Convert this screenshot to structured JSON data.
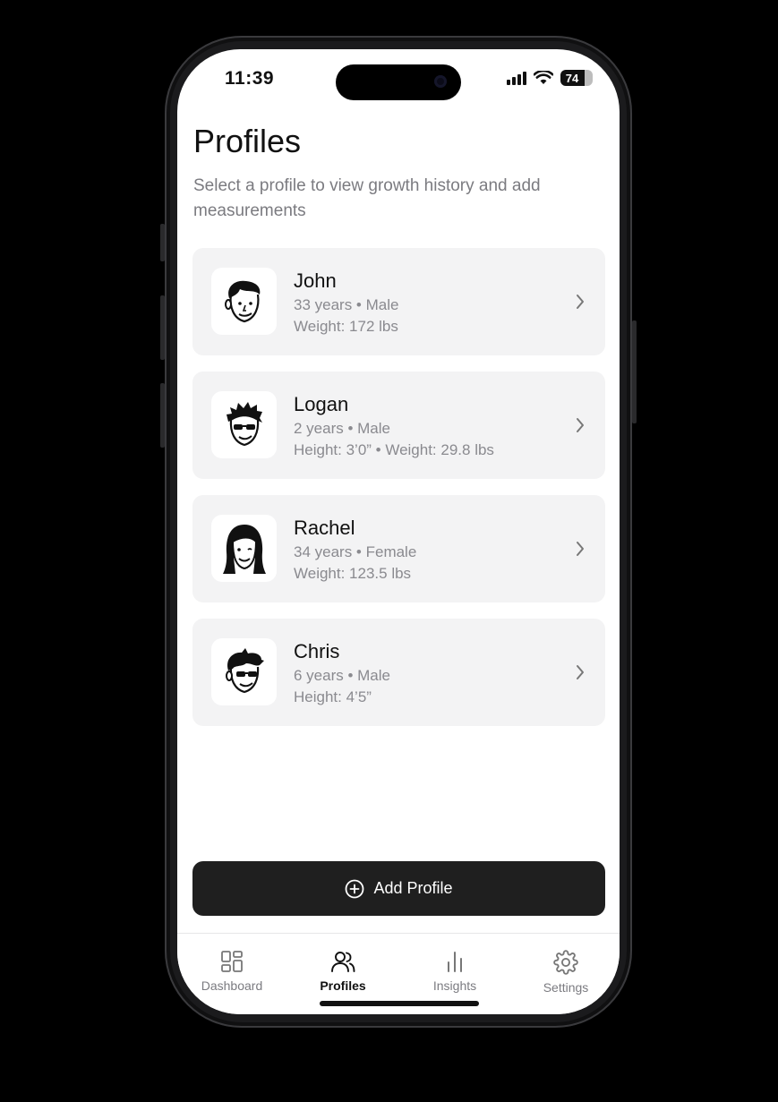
{
  "status_bar": {
    "time": "11:39",
    "battery": "74"
  },
  "page": {
    "title": "Profiles",
    "subtitle": "Select a profile to view growth history and add measurements"
  },
  "profiles": [
    {
      "name": "John",
      "details": "33 years • Male",
      "measurements": "Weight: 172 lbs"
    },
    {
      "name": "Logan",
      "details": "2 years • Male",
      "measurements": "Height: 3’0” • Weight: 29.8 lbs"
    },
    {
      "name": "Rachel",
      "details": "34 years • Female",
      "measurements": "Weight: 123.5 lbs"
    },
    {
      "name": "Chris",
      "details": "6 years • Male",
      "measurements": "Height: 4’5”"
    }
  ],
  "actions": {
    "add_profile_label": "Add Profile"
  },
  "tabbar": {
    "items": [
      {
        "label": "Dashboard",
        "icon": "grid-icon"
      },
      {
        "label": "Profiles",
        "icon": "users-icon"
      },
      {
        "label": "Insights",
        "icon": "bar-chart-icon"
      },
      {
        "label": "Settings",
        "icon": "gear-icon"
      }
    ],
    "active": "Profiles"
  },
  "colors": {
    "primary_button": "#1f1f1f",
    "card_background": "#f3f3f4",
    "muted_text": "#8a8a8f"
  }
}
